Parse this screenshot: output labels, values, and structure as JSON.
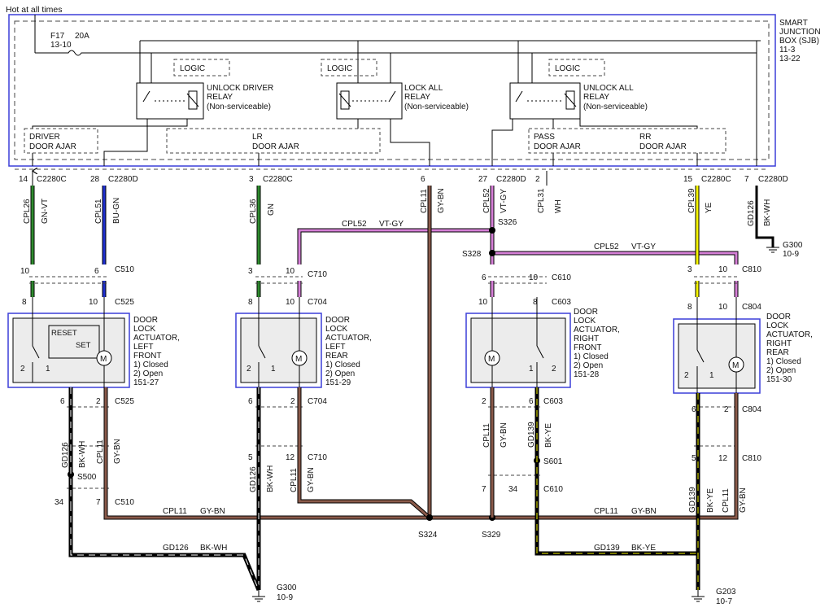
{
  "header": {
    "power_label": "Hot at all times"
  },
  "fuse": {
    "name": "F17",
    "rating": "20A",
    "ref": "13-10"
  },
  "sjb": {
    "lines": [
      "SMART",
      "JUNCTION",
      "BOX (SJB)",
      "11-3",
      "13-22"
    ]
  },
  "logic_label": "LOGIC",
  "relays": {
    "unlock_driver": [
      "UNLOCK DRIVER",
      "RELAY",
      "(Non-serviceable)"
    ],
    "lock_all": [
      "LOCK ALL",
      "RELAY",
      "(Non-serviceable)"
    ],
    "unlock_all": [
      "UNLOCK ALL",
      "RELAY",
      "(Non-serviceable)"
    ]
  },
  "switches": {
    "driver": [
      "DRIVER",
      "DOOR AJAR"
    ],
    "lr": [
      "LR",
      "DOOR AJAR"
    ],
    "pass": [
      "PASS",
      "DOOR AJAR"
    ],
    "rr": [
      "RR",
      "DOOR AJAR"
    ]
  },
  "sjb_pins": [
    {
      "pin": "14",
      "conn": "C2280C"
    },
    {
      "pin": "28",
      "conn": "C2280D"
    },
    {
      "pin": "3",
      "conn": "C2280C"
    },
    {
      "pin": "6",
      "conn": ""
    },
    {
      "pin": "27",
      "conn": "C2280D"
    },
    {
      "pin": "2",
      "conn": ""
    },
    {
      "pin": "15",
      "conn": "C2280C"
    },
    {
      "pin": "7",
      "conn": "C2280D"
    }
  ],
  "circuits_top": [
    {
      "circuit": "CPL26",
      "color": "GN-VT"
    },
    {
      "circuit": "CPL51",
      "color": "BU-GN"
    },
    {
      "circuit": "CPL36",
      "color": "GN"
    },
    {
      "circuit": "CPL11",
      "color": "GY-BN"
    },
    {
      "circuit": "CPL52",
      "color": "VT-GY"
    },
    {
      "circuit": "CPL31",
      "color": "WH"
    },
    {
      "circuit": "CPL39",
      "color": "YE"
    },
    {
      "circuit": "GD126",
      "color": "BK-WH"
    }
  ],
  "splices": {
    "s326": "S326",
    "s328": "S328",
    "s500": "S500",
    "s601": "S601",
    "s324": "S324",
    "s329": "S329"
  },
  "grounds": {
    "g300_top": [
      "G300",
      "10-9"
    ],
    "g300_bottom": [
      "G300",
      "10-9"
    ],
    "g203": [
      "G203",
      "10-7"
    ]
  },
  "horizontal_labels": {
    "cpl52_a": {
      "circuit": "CPL52",
      "color": "VT-GY"
    },
    "cpl52_b": {
      "circuit": "CPL52",
      "color": "VT-GY"
    },
    "cpl11_left": {
      "circuit": "CPL11",
      "color": "GY-BN"
    },
    "cpl11_right": {
      "circuit": "CPL11",
      "color": "GY-BN"
    },
    "gd126": {
      "circuit": "GD126",
      "color": "BK-WH"
    },
    "gd139": {
      "circuit": "GD139",
      "color": "BK-YE"
    }
  },
  "inline_connectors": {
    "c510": "C510",
    "c525": "C525",
    "c710": "C710",
    "c704": "C704",
    "c610": "C610",
    "c603": "C603",
    "c810": "C810",
    "c804": "C804"
  },
  "pin_numbers": {
    "lf": {
      "c510_left": "10",
      "c510_right": "6",
      "c525_left": "8",
      "c525_right": "10",
      "c525b_left": "6",
      "c525b_right": "2",
      "c510b_left": "34",
      "c510b_right": "7"
    },
    "lr": {
      "c710_left": "3",
      "c710_right": "10",
      "c704_left": "8",
      "c704_right": "10",
      "c704b_left": "6",
      "c704b_right": "2",
      "c710b_left": "5",
      "c710b_right": "12"
    },
    "rf": {
      "c610_left": "6",
      "c610_right": "10",
      "c603_left": "10",
      "c603_right": "8",
      "c603b_left": "2",
      "c603b_right": "6",
      "c610b_left": "7",
      "c610b_right": "34"
    },
    "rr": {
      "c810_left": "3",
      "c810_right": "10",
      "c804_left": "8",
      "c804_right": "10",
      "c804b_left": "6",
      "c804b_right": "2",
      "c810b_left": "5",
      "c810b_right": "12"
    }
  },
  "actuators": {
    "lf": {
      "title": [
        "DOOR",
        "LOCK",
        "ACTUATOR,",
        "LEFT",
        "FRONT"
      ],
      "notes": [
        "1) Closed",
        "2) Open",
        "151-27"
      ],
      "reset": "RESET",
      "set": "SET",
      "motor": "M"
    },
    "lr": {
      "title": [
        "DOOR",
        "LOCK",
        "ACTUATOR,",
        "LEFT",
        "REAR"
      ],
      "notes": [
        "1) Closed",
        "2) Open",
        "151-29"
      ],
      "motor": "M"
    },
    "rf": {
      "title": [
        "DOOR",
        "LOCK",
        "ACTUATOR,",
        "RIGHT",
        "FRONT"
      ],
      "notes": [
        "1) Closed",
        "2) Open",
        "151-28"
      ],
      "motor": "M"
    },
    "rr": {
      "title": [
        "DOOR",
        "LOCK",
        "ACTUATOR,",
        "RIGHT",
        "REAR"
      ],
      "notes": [
        "1) Closed",
        "2) Open",
        "151-30"
      ],
      "motor": "M"
    }
  },
  "switch_pin_labels": {
    "one": "1",
    "two": "2"
  },
  "bottom_circuits": {
    "lf_gd126": {
      "circuit": "GD126",
      "color": "BK-WH"
    },
    "lf_cpl11": {
      "circuit": "CPL11",
      "color": "GY-BN"
    },
    "lr_gd126": {
      "circuit": "GD126",
      "color": "BK-WH"
    },
    "lr_cpl11": {
      "circuit": "CPL11",
      "color": "GY-BN"
    },
    "rf_cpl11": {
      "circuit": "CPL11",
      "color": "GY-BN"
    },
    "rf_gd139": {
      "circuit": "GD139",
      "color": "BK-YE"
    },
    "rr_gd139": {
      "circuit": "GD139",
      "color": "BK-YE"
    },
    "rr_cpl11": {
      "circuit": "CPL11",
      "color": "GY-BN"
    }
  },
  "colors": {
    "frame": "#3b3fd8",
    "dashed": "#444444",
    "green": "#2e8b2e",
    "blue": "#1f2fd0",
    "violet": "#d57fd6",
    "yellow": "#f5f500",
    "brown": "#8a5a4a",
    "black": "#000000",
    "box_fill": "#ececec"
  }
}
